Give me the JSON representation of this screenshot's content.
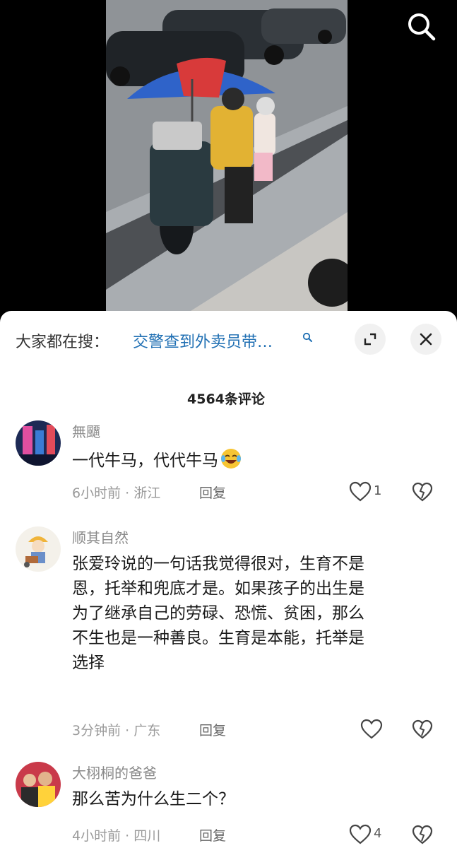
{
  "video": {
    "umbrella_text": "",
    "search_icon": "search-icon"
  },
  "sheet": {
    "suggest_prefix": "大家都在搜：",
    "suggest_query": "交警查到外卖员带…",
    "expand_icon": "expand-icon",
    "close_icon": "close-icon",
    "comment_count": "4564条评论"
  },
  "comments": [
    {
      "author": "無飅",
      "text": "一代牛马，代代牛马",
      "emoji": "laughing-crying-emoji",
      "time_location": "6小时前 · 浙江",
      "reply": "回复",
      "likes": "1"
    },
    {
      "author": "顺其自然",
      "text_lines": [
        "张爱玲说的一句话我觉得很对，生育不是",
        "恩，托举和兜底才是。如果孩子的出生是",
        "为了继承自己的劳碌、恐慌、贫困，那么",
        "不生也是一种善良。生育是本能，托举是",
        "选择"
      ],
      "time_location": "3分钟前 · 广东",
      "reply": "回复",
      "likes": ""
    },
    {
      "author": "大栩桐的爸爸",
      "text": "那么苦为什么生二个？",
      "time_location": "4小时前 · 四川",
      "reply": "回复",
      "likes": "4"
    }
  ]
}
